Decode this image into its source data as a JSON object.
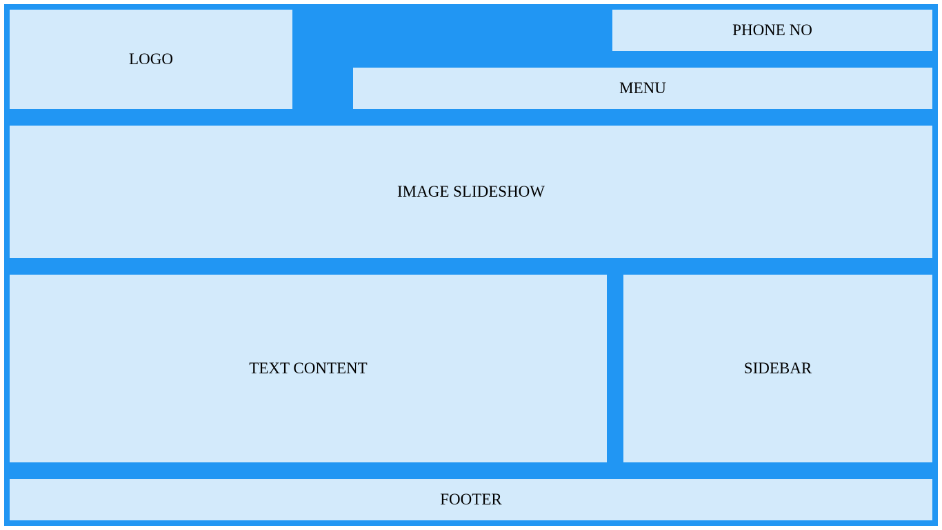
{
  "colors": {
    "frame": "#2196f3",
    "block": "#d3eafb",
    "text": "#000000"
  },
  "header": {
    "logo": "LOGO",
    "phone": "PHONE NO",
    "menu": "MENU"
  },
  "main": {
    "slideshow": "IMAGE SLIDESHOW",
    "text_content": "TEXT CONTENT",
    "sidebar": "SIDEBAR"
  },
  "footer": {
    "label": "FOOTER"
  }
}
